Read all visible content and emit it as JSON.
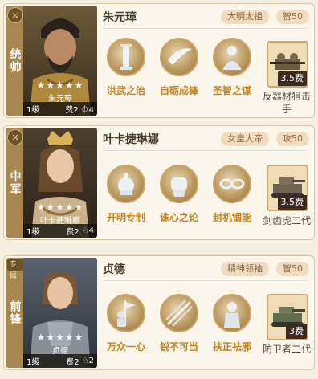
{
  "cards": [
    {
      "position_label": "统帅",
      "rail_badge": "⚔",
      "hero": {
        "name": "朱元璋",
        "stars": "★★★★★",
        "portrait_name": "朱元璋",
        "level": "1级",
        "cost": "费2",
        "extra": "⏀4"
      },
      "badges": [
        "大明太祖",
        "智50"
      ],
      "skills": [
        "洪武之治",
        "自砺成锋",
        "圣智之谋"
      ],
      "gear": {
        "cost": "3.5费",
        "label": "反器材狙击手"
      }
    },
    {
      "position_label": "中军",
      "rail_badge": "✕",
      "hero": {
        "name": "叶卡捷琳娜",
        "stars": "★★★★★",
        "portrait_name": "叶卡捷琳娜",
        "level": "1级",
        "cost": "费2",
        "extra": "♘4"
      },
      "badges": [
        "女皇大帝",
        "攻50"
      ],
      "skills": [
        "开明专制",
        "诛心之论",
        "封机锢能"
      ],
      "gear": {
        "cost": "3.5费",
        "label": "剑齿虎二代"
      }
    },
    {
      "position_label": "前锋",
      "rail_badge": "专属",
      "hero": {
        "name": "贞德",
        "stars": "★★★★★",
        "portrait_name": "贞德",
        "level": "1级",
        "cost": "费2",
        "extra": "♘2"
      },
      "badges": [
        "精神领袖",
        "智50"
      ],
      "skills": [
        "万众一心",
        "锐不可当",
        "扶正祛邪"
      ],
      "gear": {
        "cost": "3费",
        "label": "防卫者二代"
      }
    }
  ],
  "colors": {
    "rail": "#a8864f",
    "skill_label": "#c4831f",
    "badge_bg": "#f0dcc0",
    "badge_text": "#8e6b45"
  },
  "icons": {
    "skills": [
      "pillar-icon",
      "blade-icon",
      "sage-icon",
      "palace-icon",
      "fist-icon",
      "chain-icon",
      "banner-soldier-icon",
      "slash-icon",
      "knight-icon"
    ],
    "gear": [
      "sniper-soldier-icon",
      "tank-icon",
      "tank-icon"
    ]
  }
}
